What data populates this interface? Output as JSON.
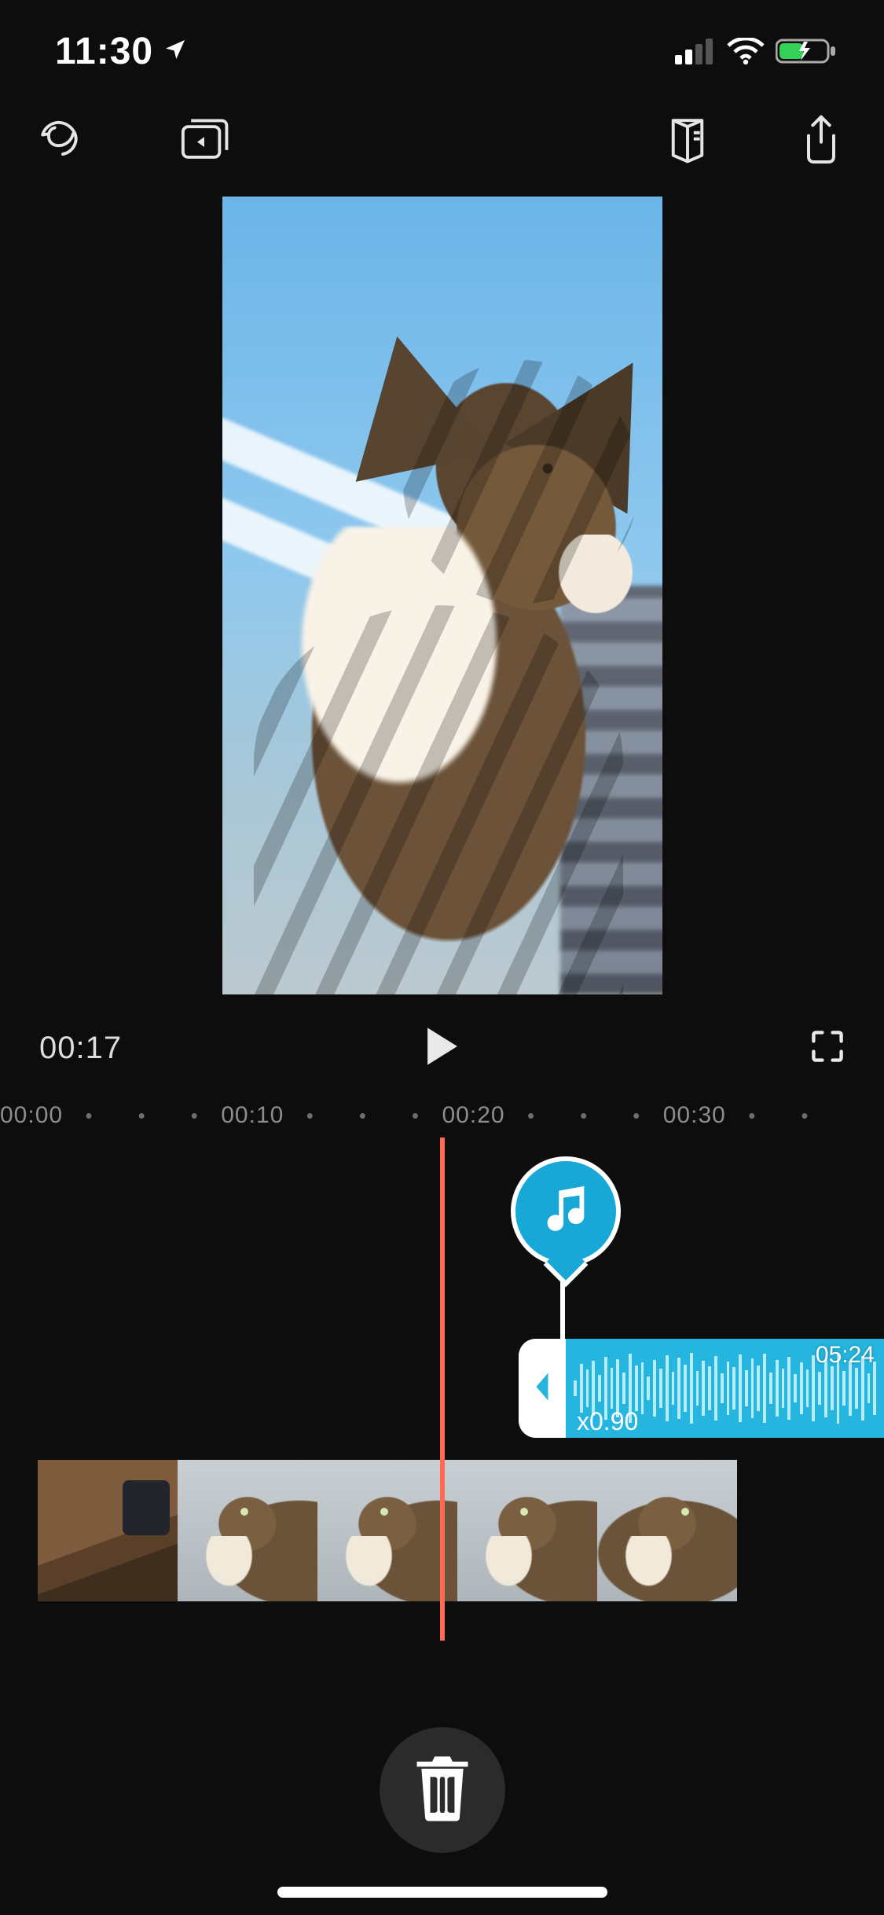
{
  "status_bar": {
    "time": "11:30",
    "location_icon": "location-arrow-icon",
    "signal_bars": 2,
    "wifi": true,
    "battery_charging": true
  },
  "toolbar": {
    "left": [
      {
        "name": "app-home-icon"
      },
      {
        "name": "library-icon"
      }
    ],
    "right": [
      {
        "name": "tutorial-icon"
      },
      {
        "name": "share-icon"
      }
    ]
  },
  "preview": {
    "subject": "cat by window"
  },
  "transport": {
    "current_time": "00:17",
    "play_label": "Play",
    "fullscreen_label": "Fullscreen"
  },
  "timeline": {
    "ruler": [
      "00:00",
      "•",
      "•",
      "•",
      "00:10",
      "•",
      "•",
      "•",
      "00:20",
      "•",
      "•",
      "•",
      "00:30",
      "•",
      "•"
    ],
    "playhead_position": "00:17",
    "audio_clip": {
      "duration": "05:24",
      "speed": "x0.90",
      "marker": "music-note-icon"
    },
    "video_thumbs": 5
  },
  "actions": {
    "delete_label": "Delete"
  }
}
